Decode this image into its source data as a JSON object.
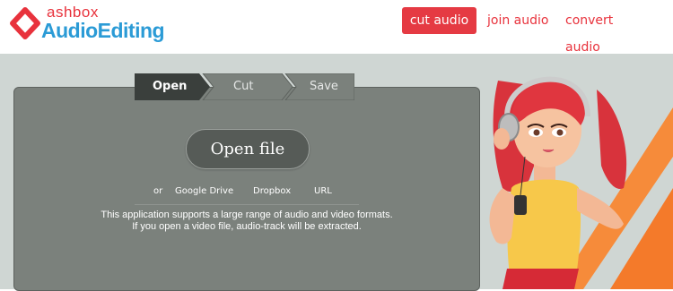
{
  "header": {
    "logo_top": "ashbox",
    "logo_bottom": "AudioEditing",
    "nav": [
      {
        "label": "cut audio",
        "active": true
      },
      {
        "label": "join audio",
        "active": false
      },
      {
        "label": "convert audio",
        "active": false
      }
    ]
  },
  "steps": [
    {
      "label": "Open",
      "active": true
    },
    {
      "label": "Cut",
      "active": false
    },
    {
      "label": "Save",
      "active": false
    }
  ],
  "open_button": "Open file",
  "sources": {
    "or": "or",
    "google_drive": "Google Drive",
    "dropbox": "Dropbox",
    "url": "URL"
  },
  "info": {
    "line1": "This application supports a large range of audio and video formats.",
    "line2": "If you open a video file, audio-track will be extracted."
  },
  "colors": {
    "brand_red": "#e53a43",
    "brand_blue": "#2b9bd6",
    "panel": "#7b817c"
  }
}
